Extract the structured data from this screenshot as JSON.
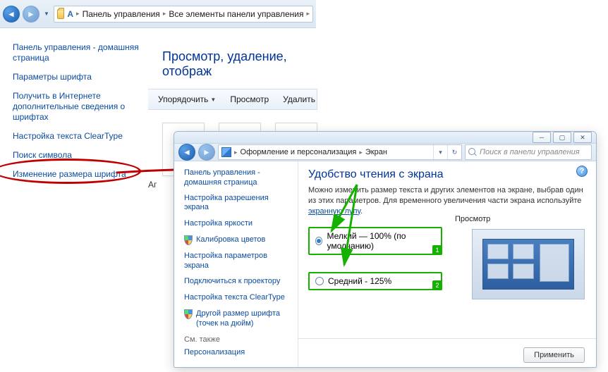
{
  "bg": {
    "breadcrumbs": [
      "Панель управления",
      "Все элементы панели управления"
    ],
    "sidebar": [
      "Панель управления - домашняя страница",
      "Параметры шрифта",
      "Получить в Интернете дополнительные сведения о шрифтах",
      "Настройка текста ClearType",
      "Поиск символа",
      "Изменение размера шрифта"
    ],
    "heading": "Просмотр, удаление, отображ",
    "toolbar": {
      "organize": "Упорядочить",
      "view": "Просмотр",
      "delete": "Удалить"
    },
    "cut_label": "Аг"
  },
  "fg": {
    "breadcrumbs": [
      "Оформление и персонализация",
      "Экран"
    ],
    "search_placeholder": "Поиск в панели управления",
    "sidebar": {
      "home": "Панель управления - домашняя страница",
      "links": [
        "Настройка разрешения экрана",
        "Настройка яркости",
        "Калибровка цветов",
        "Настройка параметров экрана",
        "Подключиться к проектору",
        "Настройка текста ClearType",
        "Другой размер шрифта (точек на дюйм)"
      ],
      "see_also_label": "См. также",
      "see_also": [
        "Персонализация"
      ]
    },
    "main": {
      "title": "Удобство чтения с экрана",
      "desc_before": "Можно изменить размер текста и других элементов на экране, выбрав один из этих параметров. Для временного увеличения части экрана используйте ",
      "desc_link": "экранную лупу",
      "desc_after": ".",
      "option1": "Мелкий — 100% (по умолчанию)",
      "option2": "Средний - 125%",
      "preview_label": "Просмотр",
      "apply": "Применить"
    }
  },
  "tags": {
    "one": "1",
    "two": "2"
  },
  "help": "?"
}
